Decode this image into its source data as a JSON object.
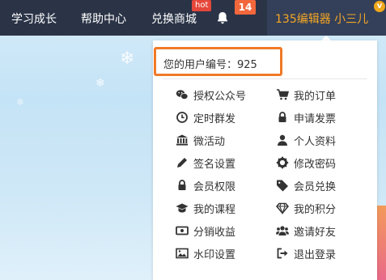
{
  "nav": {
    "items": [
      "学习成长",
      "帮助中心",
      "兑换商城"
    ],
    "hot_badge": "hot",
    "notification_count": "14"
  },
  "user": {
    "name": "135编辑器 小三儿",
    "vip_badge": "v"
  },
  "dropdown": {
    "user_id_text": "您的用户编号：925",
    "left_items": [
      {
        "label": "授权公众号",
        "icon": "wechat-icon"
      },
      {
        "label": "定时群发",
        "icon": "clock-icon"
      },
      {
        "label": "微活动",
        "icon": "bank-icon"
      },
      {
        "label": "签名设置",
        "icon": "pencil-icon"
      },
      {
        "label": "会员权限",
        "icon": "lock-icon"
      },
      {
        "label": "我的课程",
        "icon": "graduation-cap-icon"
      },
      {
        "label": "分销收益",
        "icon": "money-icon"
      },
      {
        "label": "水印设置",
        "icon": "image-icon"
      }
    ],
    "right_items": [
      {
        "label": "我的订单",
        "icon": "cart-icon"
      },
      {
        "label": "申请发票",
        "icon": "lock-icon"
      },
      {
        "label": "个人资料",
        "icon": "user-icon"
      },
      {
        "label": "修改密码",
        "icon": "gear-icon"
      },
      {
        "label": "会员兑换",
        "icon": "tag-icon"
      },
      {
        "label": "我的积分",
        "icon": "diamond-icon"
      },
      {
        "label": "邀请好友",
        "icon": "users-icon"
      },
      {
        "label": "退出登录",
        "icon": "sign-out-icon"
      }
    ]
  },
  "colors": {
    "topbar": "#2b3447",
    "accent_orange": "#f07a28",
    "username": "#f5a623",
    "badge_red": "#e5473b"
  }
}
